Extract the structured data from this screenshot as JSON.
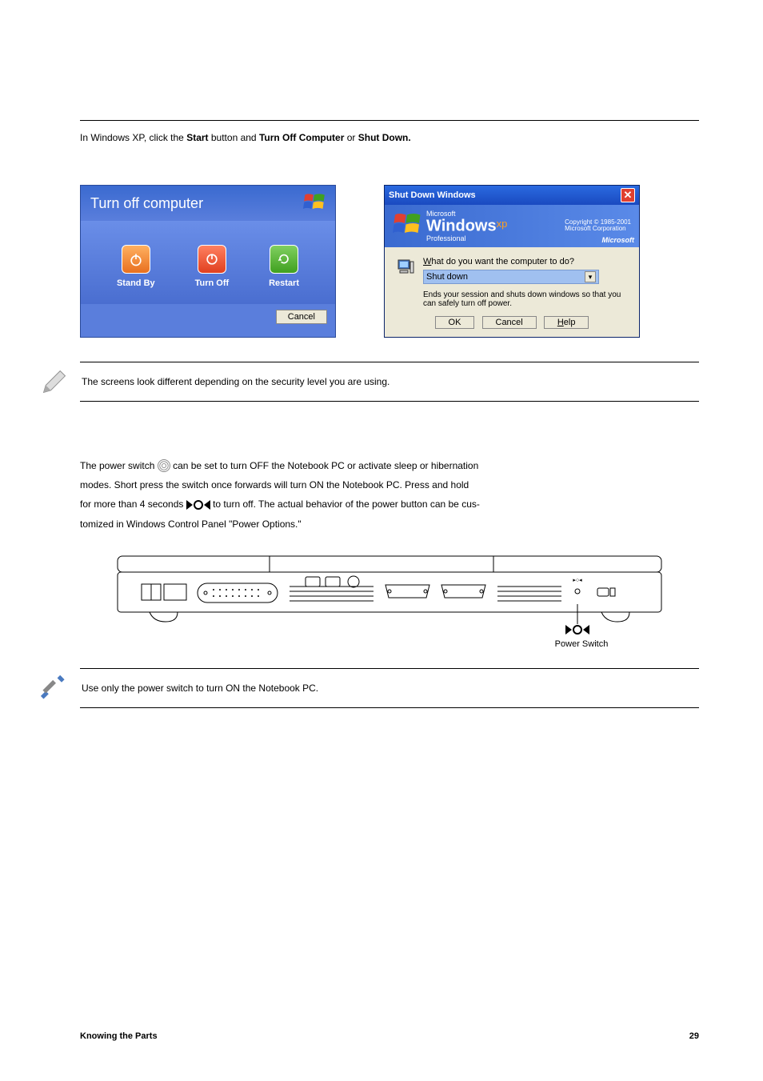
{
  "section1": {
    "intro": "In Windows XP, click the",
    "start": "Start",
    "intro2": "button and",
    "turnoff": "Turn Off Computer",
    "or": "or",
    "shutdown": "Shut Down."
  },
  "dialog1": {
    "title": "Turn off computer",
    "standby": "Stand By",
    "turnoff": "Turn Off",
    "restart": "Restart",
    "cancel": "Cancel"
  },
  "dialog2": {
    "title": "Shut Down Windows",
    "copyright1": "Copyright © 1985-2001",
    "copyright2": "Microsoft Corporation",
    "ms": "Microsoft",
    "win": "Windows",
    "xp": "xp",
    "pro": "Professional",
    "mslogo": "Microsoft",
    "question_pre": "W",
    "question": "hat do you want the computer to do?",
    "selected": "Shut down",
    "desc": "Ends your session and shuts down windows so that you can safely turn off power.",
    "ok": "OK",
    "cancel": "Cancel",
    "help_u": "H",
    "help": "elp"
  },
  "note": {
    "text": "The screens look different depending on the security level you are using."
  },
  "section2": {
    "line1_a": "The power switch",
    "line1_b": "can be set to turn OFF the Notebook PC or activate sleep or hibernation",
    "line2": "modes. Short press the switch once forwards will turn ON the Notebook PC. Press and hold",
    "line3_a": "for more than 4 seconds",
    "line3_b": "to turn off. The actual behavior of the power button can be cus-",
    "line4": "tomized in Windows Control Panel \"Power Options.\""
  },
  "pwrlabel": "Power Switch",
  "tip": {
    "text": "Use only the power switch to turn ON the Notebook PC."
  },
  "footer": {
    "left": "Knowing the Parts",
    "right": "29"
  }
}
